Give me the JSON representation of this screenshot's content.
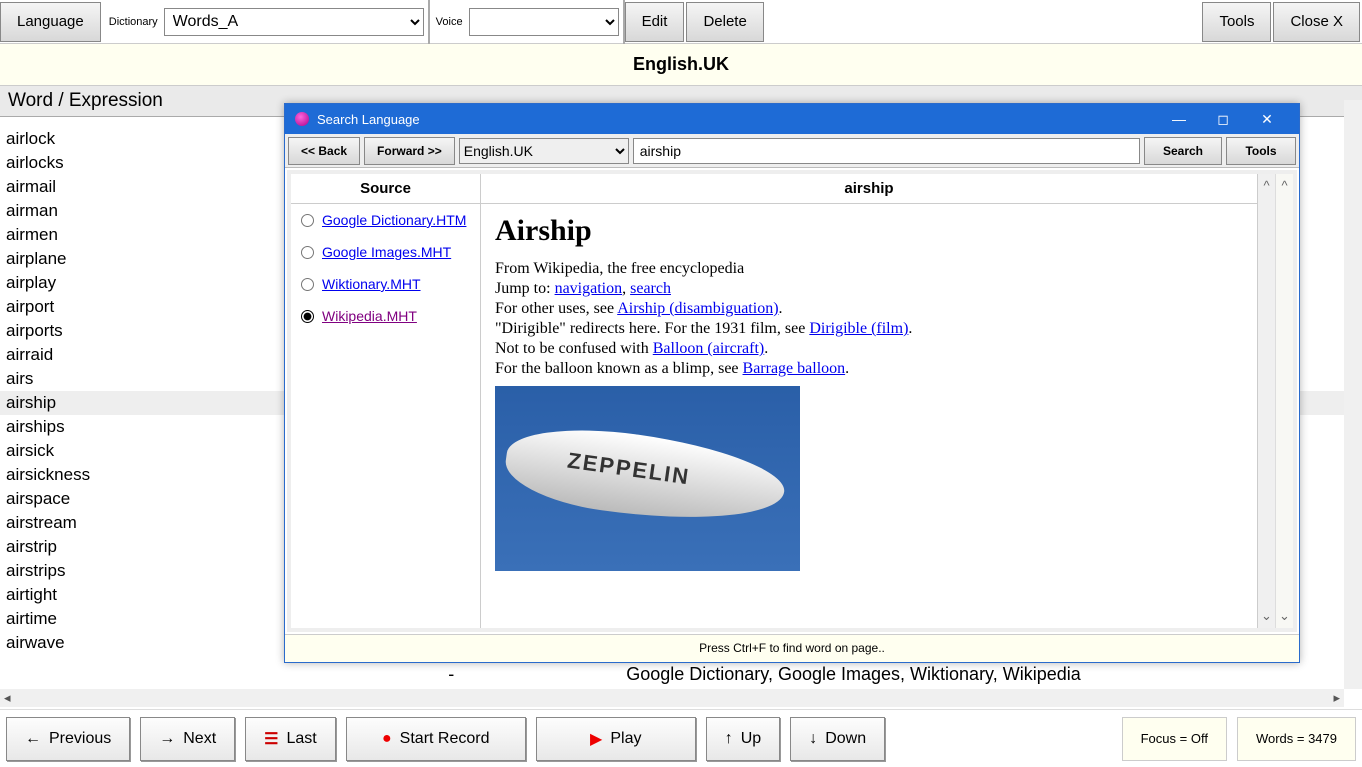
{
  "toolbar": {
    "language_btn": "Language",
    "dictionary_label": "Dictionary",
    "dictionary_value": "Words_A",
    "voice_label": "Voice",
    "voice_value": "",
    "edit_btn": "Edit",
    "delete_btn": "Delete",
    "tools_btn": "Tools",
    "close_btn": "Close X"
  },
  "language_title": "English.UK",
  "list_header": "Word / Expression",
  "words": [
    "airlock",
    "airlocks",
    "airmail",
    "airman",
    "airmen",
    "airplane",
    "airplay",
    "airport",
    "airports",
    "airraid",
    "airs",
    "airship",
    "airships",
    "airsick",
    "airsickness",
    "airspace",
    "airstream",
    "airstrip",
    "airstrips",
    "airtight",
    "airtime",
    "airwave"
  ],
  "selected_word": "airship",
  "dict_line_prefix": "-",
  "dict_line": "Google Dictionary, Google Images, Wiktionary, Wikipedia",
  "bottom": {
    "previous": "Previous",
    "next": "Next",
    "last": "Last",
    "start_record": "Start Record",
    "play": "Play",
    "up": "Up",
    "down": "Down",
    "focus": "Focus = Off",
    "words": "Words = 3479"
  },
  "modal": {
    "title": "Search Language",
    "back": "<<  Back",
    "forward": "Forward  >>",
    "lang_value": "English.UK",
    "search_value": "airship",
    "search_btn": "Search",
    "tools_btn": "Tools",
    "source_header": "Source",
    "content_header": "airship",
    "sources": [
      "Google Dictionary.HTM",
      "Google Images.MHT",
      "Wiktionary.MHT",
      "Wikipedia.MHT"
    ],
    "selected_source": "Wikipedia.MHT",
    "article": {
      "title": "Airship",
      "from": "From Wikipedia, the free encyclopedia",
      "jump": "Jump to: ",
      "nav": "navigation",
      "search": "search",
      "other_uses_pre": "For other uses, see ",
      "other_uses_link": "Airship (disambiguation)",
      "dirigible_pre": "\"Dirigible\" redirects here. For the 1931 film, see ",
      "dirigible_link": "Dirigible (film)",
      "confused_pre": "Not to be confused with ",
      "confused_link": "Balloon (aircraft)",
      "blimp_pre": "For the balloon known as a blimp, see ",
      "blimp_link": "Barrage balloon",
      "image_text": "ZEPPELIN"
    },
    "footer": "Press Ctrl+F to find word on page.."
  }
}
